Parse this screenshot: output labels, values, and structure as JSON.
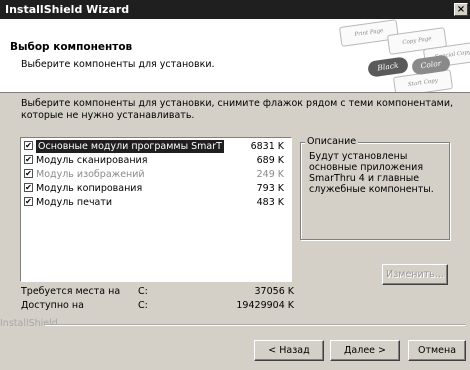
{
  "window": {
    "title": "InstallShield Wizard",
    "close_glyph": "×"
  },
  "header": {
    "title": "Выбор компонентов",
    "subtitle": "Выберите компоненты для установки.",
    "art": {
      "sheets": [
        "Print Page",
        "Copy Page",
        "Special Copy",
        "Draft Copy"
      ],
      "buttons": [
        "Black",
        "Color"
      ],
      "caption": "Start Copy"
    }
  },
  "instruction": "Выберите компоненты для установки, снимите флажок рядом с теми компонентами, которые не нужно устанавливать.",
  "components": [
    {
      "name": "Основные модули программы SmarT",
      "size": "6831 K",
      "checked": true,
      "enabled": true,
      "selected": true
    },
    {
      "name": "Модуль сканирования",
      "size": "689 K",
      "checked": true,
      "enabled": true,
      "selected": false
    },
    {
      "name": "Модуль изображений",
      "size": "249 K",
      "checked": true,
      "enabled": false,
      "selected": false
    },
    {
      "name": "Модуль копирования",
      "size": "793 K",
      "checked": true,
      "enabled": true,
      "selected": false
    },
    {
      "name": "Модуль печати",
      "size": "483 K",
      "checked": true,
      "enabled": true,
      "selected": false
    }
  ],
  "description": {
    "legend": "Описание",
    "text": "Будут установлены основные приложения SmarThru 4 и главные служебные компоненты."
  },
  "change_button": "Изменить...",
  "space": {
    "required_label": "Требуется места на",
    "required_drive": "C:",
    "required_value": "37056 K",
    "available_label": "Доступно на",
    "available_drive": "C:",
    "available_value": "19429904 K"
  },
  "brand": "InstallShield",
  "buttons": {
    "back": "< Назад",
    "next": "Далее >",
    "cancel": "Отмена"
  },
  "checkbox_glyph": "✔",
  "colors": {
    "selection": "#1f1f1f",
    "dialog": "#d4d0c8",
    "titlebar": "#1f1f1f"
  }
}
